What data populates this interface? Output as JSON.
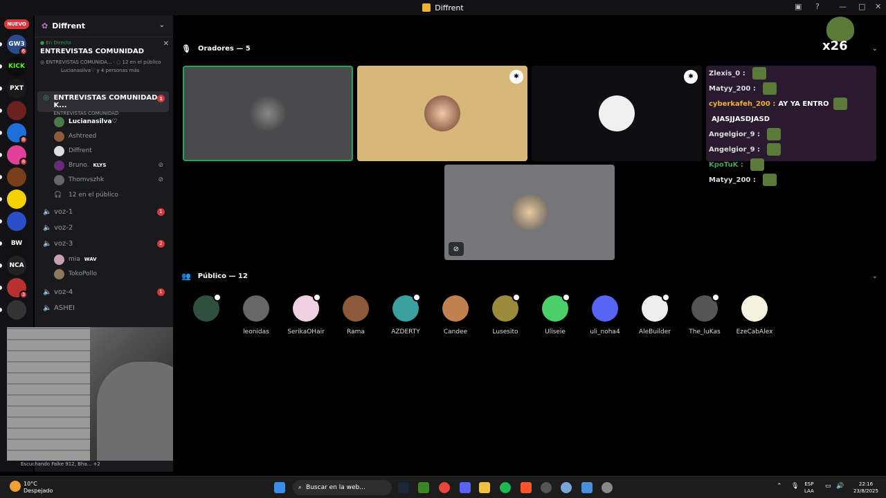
{
  "window": {
    "title": "Diffrent"
  },
  "rail": {
    "new_badge": "NUEVO",
    "servers": [
      {
        "label": "GW3",
        "badge": "6"
      },
      {
        "label": "KICK",
        "badge": ""
      },
      {
        "label": "PXT",
        "badge": ""
      },
      {
        "label": "",
        "badge": ""
      },
      {
        "label": "",
        "badge": "8"
      },
      {
        "label": "",
        "badge": "8"
      },
      {
        "label": "",
        "badge": ""
      },
      {
        "label": "",
        "badge": ""
      },
      {
        "label": "",
        "badge": ""
      },
      {
        "label": "BW",
        "badge": ""
      },
      {
        "label": "NCA",
        "badge": ""
      },
      {
        "label": "",
        "badge": "3"
      },
      {
        "label": "",
        "badge": ""
      }
    ]
  },
  "sidebar": {
    "server_name": "Diffrent",
    "stage": {
      "live_label": "En Directo",
      "title": "ENTREVISTAS COMUNIDAD",
      "subtitle": "ENTREVISTAS COMUNIDA...",
      "listeners": "12 en el público",
      "people": "Lucianasilva♡ y 4 personas más"
    },
    "active_channel": {
      "name": "ENTREVISTAS COMUNIDAD K...",
      "topic": "ENTREVISTAS COMUNIDAD",
      "badge": "1"
    },
    "stage_members": [
      {
        "name": "Lucianasilva♡",
        "tag": "",
        "muted": false
      },
      {
        "name": "Ashtreed",
        "tag": "",
        "muted": false
      },
      {
        "name": "Diffrent",
        "tag": "",
        "muted": false
      },
      {
        "name": "Bruno.",
        "tag": "KLYS",
        "muted": true
      },
      {
        "name": "Thomvszhk",
        "tag": "",
        "muted": true
      }
    ],
    "stage_listeners": "12 en el público",
    "voice_channels": [
      {
        "name": "voz-1",
        "badge": "1"
      },
      {
        "name": "voz-2",
        "badge": ""
      },
      {
        "name": "voz-3",
        "badge": "2"
      }
    ],
    "voz3_members": [
      {
        "name": "mia",
        "tag": "WAV"
      },
      {
        "name": "TokoPollo",
        "tag": ""
      }
    ],
    "more_channels": [
      {
        "name": "voz-4",
        "badge": "1"
      },
      {
        "name": "ASHEI",
        "badge": ""
      }
    ],
    "user_status": "Escuchando Falke 912, Bha...  +2"
  },
  "main": {
    "speakers_header": "Oradores — 5",
    "audience_header": "Público — 12",
    "overlay_text": "x26",
    "chat": [
      {
        "user": "Zlexis_0 :",
        "text": "",
        "color": "#dbdee1"
      },
      {
        "user": "Matyy_200 :",
        "text": "",
        "color": "#dbdee1"
      },
      {
        "user": "cyberkafeh_200 :",
        "text": "AY YA ENTRO",
        "color": "#f0b232"
      },
      {
        "user": "",
        "text": "AJASJJASDJASD",
        "color": "#dbdee1"
      },
      {
        "user": "Angelgior_9 :",
        "text": "",
        "color": "#dbdee1"
      },
      {
        "user": "Angelgior_9 :",
        "text": "",
        "color": "#dbdee1"
      },
      {
        "user": "KpoTuK :",
        "text": "",
        "color": "#3ba55d"
      },
      {
        "user": "Matyy_200 :",
        "text": "",
        "color": "#dbdee1"
      }
    ],
    "audience": [
      "",
      "leonidas",
      "SerikaOHair",
      "Rama",
      "AZDERTY",
      "Candee",
      "Lusesito",
      "Uliseie",
      "uli_noha4",
      "AleBuilder",
      "The_luKas",
      "EzeCabAlex"
    ]
  },
  "taskbar": {
    "weather_temp": "10°C",
    "weather_desc": "Despejado",
    "search_placeholder": "Buscar en la web...",
    "lang": "ESP",
    "lang2": "LAA",
    "time": "22:16",
    "date": "23/8/2025"
  }
}
